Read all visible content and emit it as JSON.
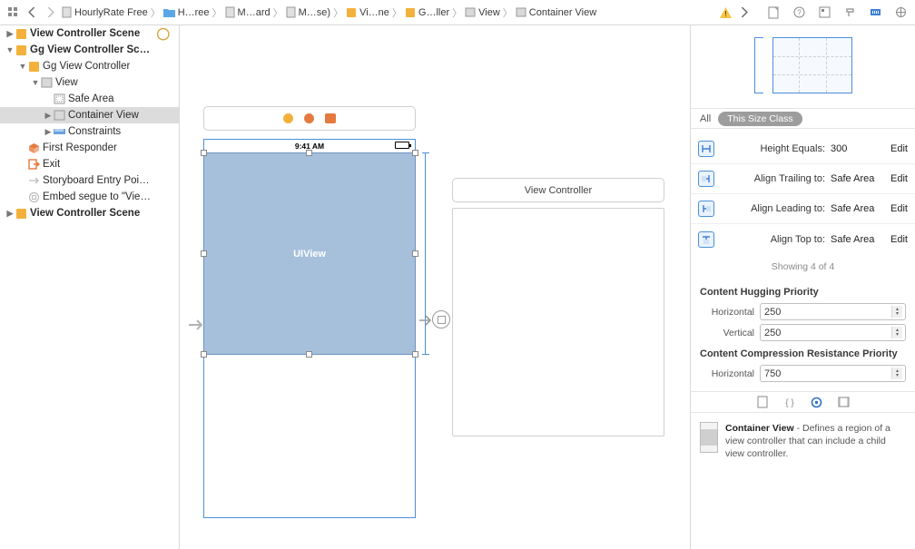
{
  "breadcrumbs": [
    {
      "label": "HourlyRate Free",
      "icon": "file"
    },
    {
      "label": "H…ree",
      "icon": "folder"
    },
    {
      "label": "M…ard",
      "icon": "file"
    },
    {
      "label": "M…se)",
      "icon": "file"
    },
    {
      "label": "Vi…ne",
      "icon": "scene"
    },
    {
      "label": "G…ller",
      "icon": "scene"
    },
    {
      "label": "View",
      "icon": "view"
    },
    {
      "label": "Container View",
      "icon": "view"
    }
  ],
  "outline": [
    {
      "depth": 0,
      "disc": "▶",
      "icon": "scene",
      "label": "View Controller Scene",
      "bold": true,
      "add": true
    },
    {
      "depth": 0,
      "disc": "▼",
      "icon": "scene",
      "label": "Gg View Controller Sc…",
      "bold": true
    },
    {
      "depth": 1,
      "disc": "▼",
      "icon": "scene",
      "label": "Gg View Controller"
    },
    {
      "depth": 2,
      "disc": "▼",
      "icon": "view",
      "label": "View"
    },
    {
      "depth": 3,
      "disc": "",
      "icon": "safe",
      "label": "Safe Area"
    },
    {
      "depth": 3,
      "disc": "▶",
      "icon": "view",
      "label": "Container View",
      "sel": true
    },
    {
      "depth": 3,
      "disc": "▶",
      "icon": "ruler",
      "label": "Constraints"
    },
    {
      "depth": 1,
      "disc": "",
      "icon": "cube",
      "label": "First Responder"
    },
    {
      "depth": 1,
      "disc": "",
      "icon": "exit",
      "label": "Exit"
    },
    {
      "depth": 1,
      "disc": "",
      "icon": "arrow",
      "label": "Storyboard Entry Poi…"
    },
    {
      "depth": 1,
      "disc": "",
      "icon": "embed",
      "label": "Embed segue to \"Vie…"
    },
    {
      "depth": 0,
      "disc": "▶",
      "icon": "scene",
      "label": "View Controller Scene",
      "bold": true
    }
  ],
  "canvas": {
    "time": "9:41 AM",
    "selected_label": "UIView",
    "scene2_title": "View Controller"
  },
  "size_tabs": {
    "all": "All",
    "this": "This Size Class"
  },
  "constraints": [
    {
      "label": "Height Equals:",
      "value": "300",
      "edit": "Edit",
      "style": "h"
    },
    {
      "label": "Align Trailing to:",
      "value": "Safe Area",
      "edit": "Edit",
      "style": "t"
    },
    {
      "label": "Align Leading to:",
      "value": "Safe Area",
      "edit": "Edit",
      "style": "l"
    },
    {
      "label": "Align Top to:",
      "value": "Safe Area",
      "edit": "Edit",
      "style": "top"
    }
  ],
  "showing": "Showing 4 of 4",
  "hugging": {
    "title": "Content Hugging Priority",
    "h_label": "Horizontal",
    "h_val": "250",
    "v_label": "Vertical",
    "v_val": "250"
  },
  "compression": {
    "title": "Content Compression Resistance Priority",
    "h_label": "Horizontal",
    "h_val": "750"
  },
  "desc": {
    "title": "Container View",
    "body": " - Defines a region of a view controller that can include a child view controller."
  }
}
